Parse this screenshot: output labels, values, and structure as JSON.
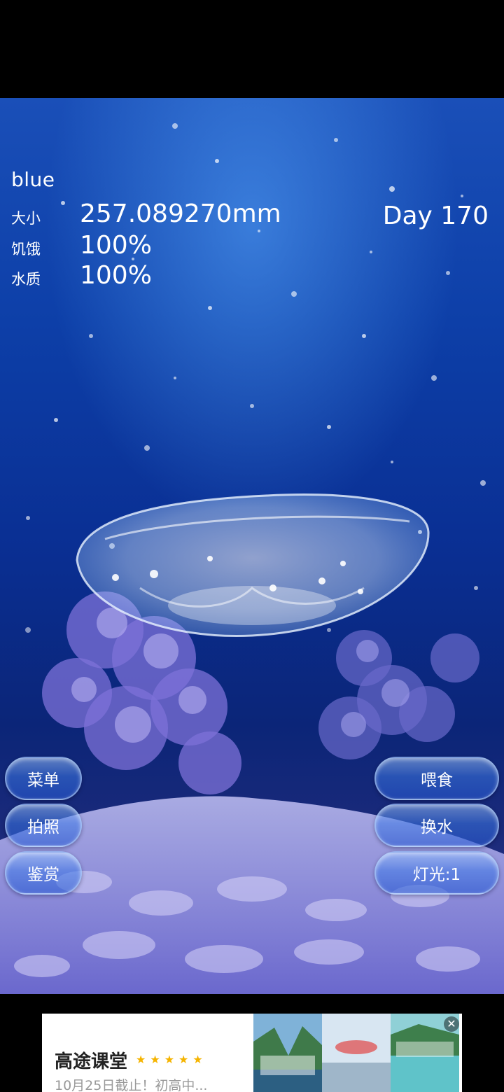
{
  "pet": {
    "name": "blue"
  },
  "stats": {
    "size_label": "大小",
    "size_value": "257.089270mm",
    "hunger_label": "饥饿",
    "hunger_value": "100%",
    "water_label": "水质",
    "water_value": "100%",
    "day": "Day 170"
  },
  "buttons": {
    "menu": "菜单",
    "photo": "拍照",
    "appreciate": "鉴赏",
    "feed": "喂食",
    "change_water": "换水",
    "light": "灯光:1"
  },
  "ad": {
    "title": "高途课堂",
    "stars": "★★★★★",
    "subtitle": "10月25日截止！初高中...",
    "close_icon": "close-icon",
    "star_color": "#f5b400"
  }
}
